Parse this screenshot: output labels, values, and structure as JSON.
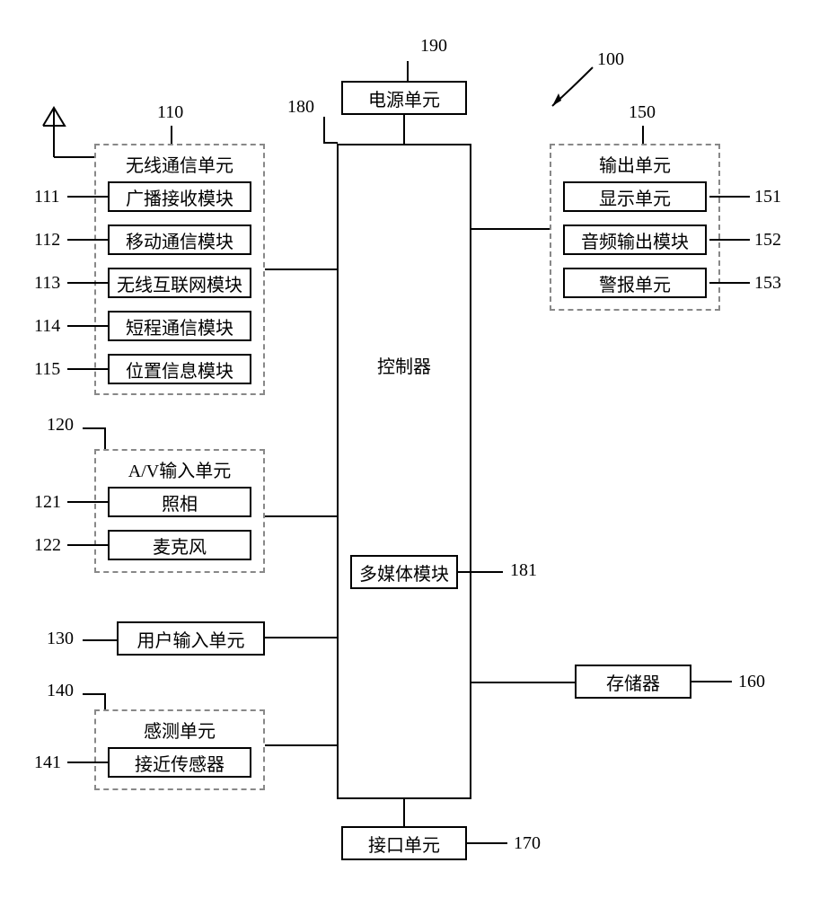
{
  "refs": {
    "r100": "100",
    "r110": "110",
    "r111": "111",
    "r112": "112",
    "r113": "113",
    "r114": "114",
    "r115": "115",
    "r120": "120",
    "r121": "121",
    "r122": "122",
    "r130": "130",
    "r140": "140",
    "r141": "141",
    "r150": "150",
    "r151": "151",
    "r152": "152",
    "r153": "153",
    "r160": "160",
    "r170": "170",
    "r180": "180",
    "r181": "181",
    "r190": "190"
  },
  "blocks": {
    "power_unit": "电源单元",
    "controller": "控制器",
    "multimedia_module": "多媒体模块",
    "wireless_unit_title": "无线通信单元",
    "broadcast_rx": "广播接收模块",
    "mobile_comm": "移动通信模块",
    "wireless_internet": "无线互联网模块",
    "short_range": "短程通信模块",
    "position_info": "位置信息模块",
    "av_input_title": "A/V输入单元",
    "camera": "照相",
    "microphone": "麦克风",
    "user_input": "用户输入单元",
    "sensing_unit_title": "感测单元",
    "proximity_sensor": "接近传感器",
    "interface_unit": "接口单元",
    "output_unit_title": "输出单元",
    "display_unit": "显示单元",
    "audio_output": "音频输出模块",
    "alarm_unit": "警报单元",
    "memory": "存储器"
  }
}
